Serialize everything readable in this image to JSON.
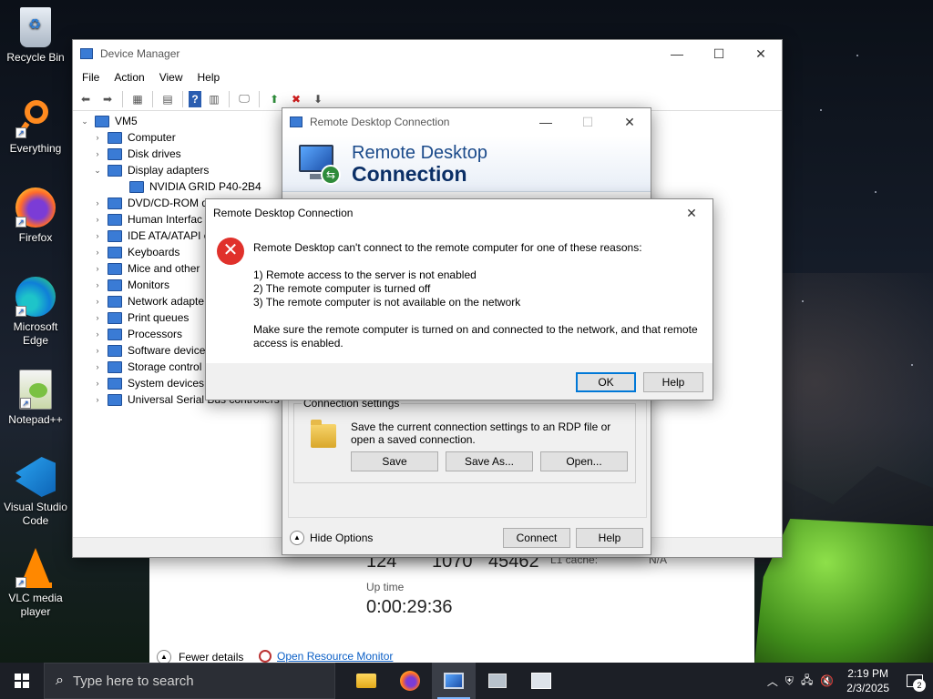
{
  "desktop": {
    "icons": [
      {
        "label": "Recycle Bin",
        "icon": "recycle-bin-icon"
      },
      {
        "label": "Everything",
        "icon": "everything-search-icon"
      },
      {
        "label": "Firefox",
        "icon": "firefox-icon"
      },
      {
        "label": "Microsoft Edge",
        "icon": "edge-icon"
      },
      {
        "label": "Notepad++",
        "icon": "notepadpp-icon"
      },
      {
        "label": "Visual Studio Code",
        "icon": "vscode-icon"
      },
      {
        "label": "VLC media player",
        "icon": "vlc-icon"
      }
    ]
  },
  "device_manager": {
    "title": "Device Manager",
    "menu": [
      "File",
      "Action",
      "View",
      "Help"
    ],
    "root": "VM5",
    "tree": [
      {
        "label": "Computer",
        "expanded": false
      },
      {
        "label": "Disk drives",
        "expanded": false
      },
      {
        "label": "Display adapters",
        "expanded": true
      },
      {
        "label": "NVIDIA GRID P40-2B4",
        "child": true
      },
      {
        "label": "DVD/CD-ROM d",
        "expanded": false
      },
      {
        "label": "Human Interfac",
        "expanded": false
      },
      {
        "label": "IDE ATA/ATAPI c",
        "expanded": false
      },
      {
        "label": "Keyboards",
        "expanded": false
      },
      {
        "label": "Mice and other",
        "expanded": false
      },
      {
        "label": "Monitors",
        "expanded": false
      },
      {
        "label": "Network adapte",
        "expanded": false
      },
      {
        "label": "Print queues",
        "expanded": false
      },
      {
        "label": "Processors",
        "expanded": false
      },
      {
        "label": "Software device",
        "expanded": false
      },
      {
        "label": "Storage control",
        "expanded": false
      },
      {
        "label": "System devices",
        "expanded": false
      },
      {
        "label": "Universal Serial Bus controllers",
        "expanded": false
      }
    ]
  },
  "resource_monitor": {
    "values": [
      "124",
      "1070",
      "45462"
    ],
    "l1_cache_label": "L1 cache:",
    "l1_cache_value": "N/A",
    "uptime_label": "Up time",
    "uptime_value": "0:00:29:36",
    "fewer_details": "Fewer details",
    "open_resource_monitor": "Open Resource Monitor"
  },
  "rdc": {
    "title": "Remote Desktop Connection",
    "brand_line1": "Remote Desktop",
    "brand_line2": "Connection",
    "connection_settings_label": "Connection settings",
    "connection_settings_text": "Save the current connection settings to an RDP file or open a saved connection.",
    "save_label": "Save",
    "save_as_label": "Save As...",
    "open_label": "Open...",
    "hide_options_label": "Hide Options",
    "connect_label": "Connect",
    "help_label": "Help"
  },
  "error_dialog": {
    "title": "Remote Desktop Connection",
    "intro": "Remote Desktop can't connect to the remote computer for one of these reasons:",
    "reasons": [
      "1) Remote access to the server is not enabled",
      "2) The remote computer is turned off",
      "3) The remote computer is not available on the network"
    ],
    "advice": "Make sure the remote computer is turned on and connected to the network, and that remote access is enabled.",
    "ok_label": "OK",
    "help_label": "Help"
  },
  "taskbar": {
    "search_placeholder": "Type here to search",
    "apps": [
      "file-explorer-icon",
      "firefox-icon",
      "remote-desktop-icon",
      "device-manager-icon",
      "task-manager-icon"
    ],
    "time": "2:19 PM",
    "date": "2/3/2025",
    "notification_count": "2"
  }
}
